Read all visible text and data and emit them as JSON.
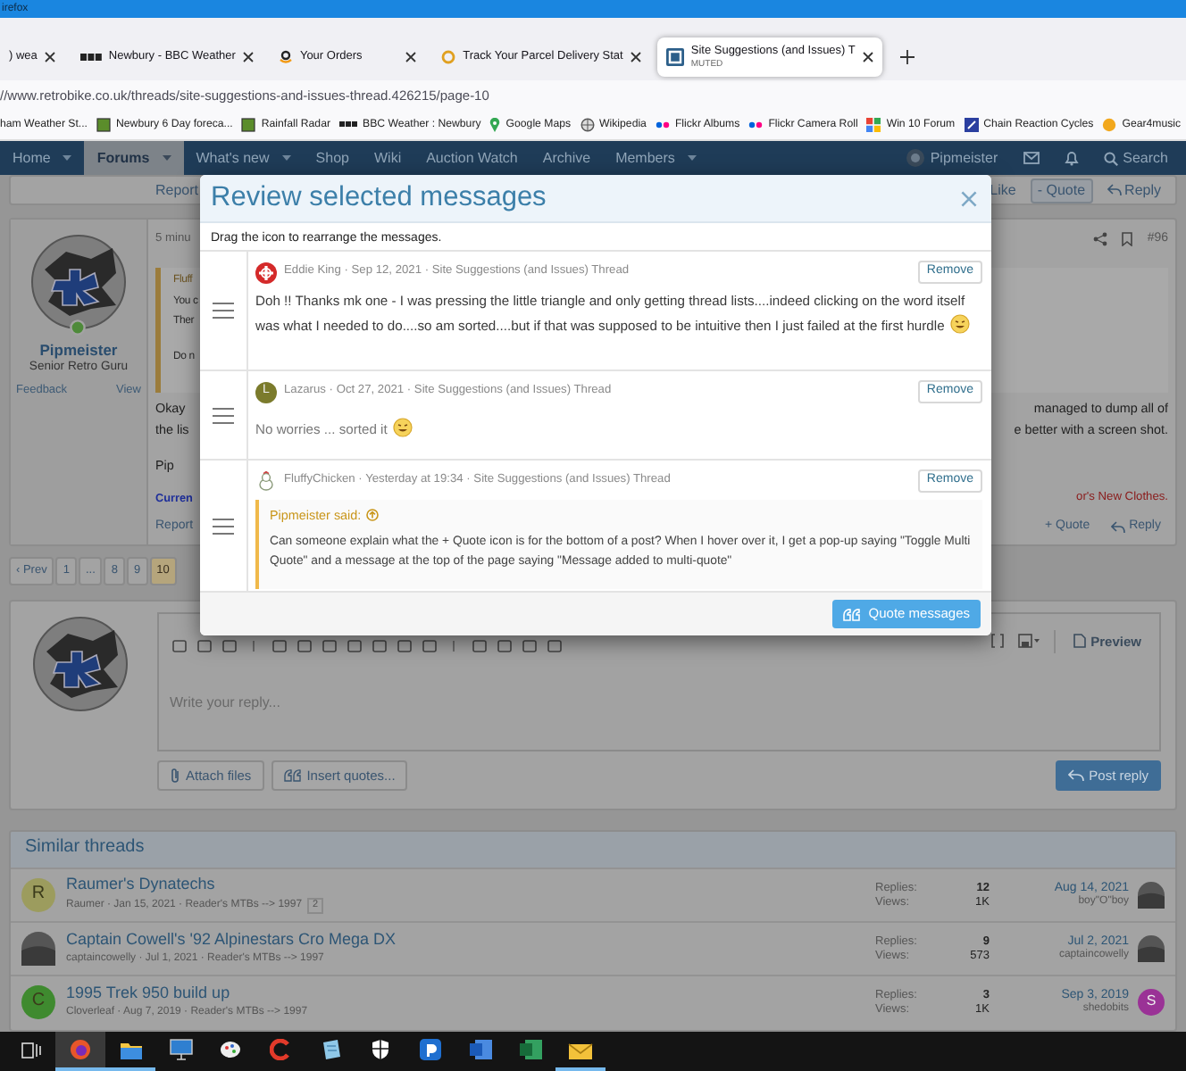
{
  "browser": {
    "window_title": "irefox",
    "tabs": [
      {
        "kind": "blank",
        "title": ") wea",
        "selected": false
      },
      {
        "kind": "bbc",
        "title": "Newbury - BBC Weather",
        "selected": false
      },
      {
        "kind": "amazon",
        "title": "Your Orders",
        "selected": false
      },
      {
        "kind": "parcel",
        "title": "Track Your Parcel Delivery Stat",
        "selected": false
      },
      {
        "kind": "site",
        "title": "Site Suggestions (and Issues) T",
        "subtitle": "MUTED",
        "selected": true
      }
    ],
    "url": "//www.retrobike.co.uk/threads/site-suggestions-and-issues-thread.426215/page-10",
    "bookmarks": [
      {
        "kind": "none",
        "label": "ham Weather St..."
      },
      {
        "kind": "green",
        "label": "Newbury 6 Day foreca..."
      },
      {
        "kind": "green",
        "label": "Rainfall Radar"
      },
      {
        "kind": "bbc",
        "label": "BBC Weather : Newbury"
      },
      {
        "kind": "pin",
        "label": "Google Maps"
      },
      {
        "kind": "wiki",
        "label": "Wikipedia"
      },
      {
        "kind": "dots",
        "label": "Flickr Albums"
      },
      {
        "kind": "dots",
        "label": "Flickr Camera Roll"
      },
      {
        "kind": "puzzle",
        "label": "Win 10 Forum"
      },
      {
        "kind": "square",
        "label": "Chain Reaction Cycles"
      },
      {
        "kind": "orange",
        "label": "Gear4music"
      }
    ]
  },
  "site_nav": {
    "items": [
      {
        "label": "Home",
        "selected": false,
        "dropdown": true
      },
      {
        "label": "Forums",
        "selected": true,
        "dropdown": true
      },
      {
        "label": "What's new",
        "selected": false,
        "dropdown": true
      },
      {
        "label": "Shop",
        "selected": false,
        "dropdown": false
      },
      {
        "label": "Wiki",
        "selected": false,
        "dropdown": false
      },
      {
        "label": "Auction Watch",
        "selected": false,
        "dropdown": false
      },
      {
        "label": "Archive",
        "selected": false,
        "dropdown": false
      },
      {
        "label": "Members",
        "selected": false,
        "dropdown": true
      }
    ],
    "user": "Pipmeister",
    "search": "Search"
  },
  "previous_post": {
    "report": "Report",
    "actions": [
      {
        "kind": "like",
        "label": "Like",
        "selected": false
      },
      {
        "kind": "quote",
        "label": "- Quote",
        "selected": true
      },
      {
        "kind": "reply",
        "label": "Reply",
        "selected": false
      }
    ]
  },
  "post": {
    "user": "Pipmeister",
    "online": true,
    "user_title": "Senior Retro Guru",
    "feedback": "Feedback",
    "view": "View",
    "time": "5 minu",
    "number": "#96",
    "quote_lines": [
      "Fluff",
      "You c",
      "Ther",
      "Do n"
    ],
    "left_lines": [
      "Okay",
      "the lis",
      "Pip"
    ],
    "right_lines": [
      "managed to dump all of",
      "e better with a screen shot."
    ],
    "signature_left": "Curren",
    "signature_right": "or's New Clothes.",
    "report": "Report",
    "actions": [
      {
        "kind": "quote",
        "label": "+ Quote",
        "selected": false
      },
      {
        "kind": "reply",
        "label": "Reply",
        "selected": false
      }
    ]
  },
  "pagination": [
    {
      "label": "‹ Prev",
      "selected": false
    },
    {
      "label": "1",
      "selected": false
    },
    {
      "label": "...",
      "selected": false
    },
    {
      "label": "8",
      "selected": false
    },
    {
      "label": "9",
      "selected": false
    },
    {
      "label": "10",
      "selected": true
    }
  ],
  "reply_editor": {
    "placeholder": "Write your reply...",
    "preview": "Preview",
    "attach": "Attach files",
    "insert_quotes": "Insert quotes...",
    "post_reply": "Post reply"
  },
  "similar_threads": {
    "title": "Similar threads",
    "rows": [
      {
        "avatar": {
          "kind": "letter",
          "letter": "R",
          "color": "#9c9c5e"
        },
        "title": "Raumer's Dynatechs",
        "meta": "Raumer · Jan 15, 2021 · Reader's MTBs --> 1997",
        "pages": [
          "2"
        ],
        "replies_label": "Replies:",
        "replies": "12",
        "views_label": "Views:",
        "views": "1K",
        "last_date": "Aug 14, 2021",
        "last_user": "boy\"O\"boy",
        "last_avatar": {
          "kind": "photo"
        }
      },
      {
        "avatar": {
          "kind": "photo"
        },
        "title": "Captain Cowell's '92 Alpinestars Cro Mega DX",
        "meta": "captaincowelly · Jul 1, 2021 · Reader's MTBs --> 1997",
        "replies_label": "Replies:",
        "replies": "9",
        "views_label": "Views:",
        "views": "573",
        "last_date": "Jul 2, 2021",
        "last_user": "captaincowelly",
        "last_avatar": {
          "kind": "photo"
        }
      },
      {
        "avatar": {
          "kind": "letter",
          "letter": "C",
          "color": "#3f8a2f"
        },
        "title": "1995 Trek 950 build up",
        "meta": "Cloverleaf · Aug 7, 2019 · Reader's MTBs --> 1997",
        "replies_label": "Replies:",
        "replies": "3",
        "views_label": "Views:",
        "views": "1K",
        "last_date": "Sep 3, 2019",
        "last_user": "shedobits",
        "last_avatar": {
          "kind": "letter",
          "letter": "S",
          "color": "#9a3296"
        }
      }
    ]
  },
  "taskbar": [
    {
      "kind": "taskview",
      "selected": false,
      "running": false
    },
    {
      "kind": "browser",
      "selected": true,
      "running": true
    },
    {
      "kind": "folder",
      "selected": false,
      "running": true
    },
    {
      "kind": "monitor",
      "selected": false,
      "running": false
    },
    {
      "kind": "palette",
      "selected": false,
      "running": false
    },
    {
      "kind": "cleaner",
      "selected": false,
      "running": false
    },
    {
      "kind": "notepad",
      "selected": false,
      "running": false
    },
    {
      "kind": "shield",
      "selected": false,
      "running": false
    },
    {
      "kind": "app",
      "selected": false,
      "running": false
    },
    {
      "kind": "word",
      "selected": false,
      "running": false
    },
    {
      "kind": "excel",
      "selected": false,
      "running": false
    },
    {
      "kind": "mail",
      "selected": false,
      "running": true
    }
  ],
  "modal": {
    "title": "Review selected messages",
    "hint": "Drag the icon to rearrange the messages.",
    "items": [
      {
        "avatar": {
          "kind": "badge",
          "color": "#d42a2a"
        },
        "meta": "Eddie King · Sep 12, 2021 · Site Suggestions (and Issues) Thread",
        "remove": "Remove",
        "body": "Doh !! Thanks mk one - I was pressing the little triangle and only getting thread lists....indeed clicking on the word itself was what I needed to do....so am sorted....but if that was supposed to be intuitive then I just failed at the first hurdle",
        "emoji": true
      },
      {
        "avatar": {
          "kind": "letter",
          "letter": "L",
          "color": "#7b7b2c"
        },
        "meta": "Lazarus · Oct 27, 2021 · Site Suggestions (and Issues) Thread",
        "remove": "Remove",
        "body": "No worries ... sorted it",
        "emoji": true
      },
      {
        "avatar": {
          "kind": "chicken"
        },
        "meta": "FluffyChicken · Yesterday at 19:34 · Site Suggestions (and Issues) Thread",
        "remove": "Remove",
        "quote": {
          "author": "Pipmeister said:",
          "text": "Can someone explain what the + Quote icon is for the bottom of a post? When I hover over it, I get a pop-up saying \"Toggle Multi Quote\" and a message at the top of the page saying \"Message added to multi-quote\""
        }
      }
    ],
    "submit": "Quote messages"
  }
}
